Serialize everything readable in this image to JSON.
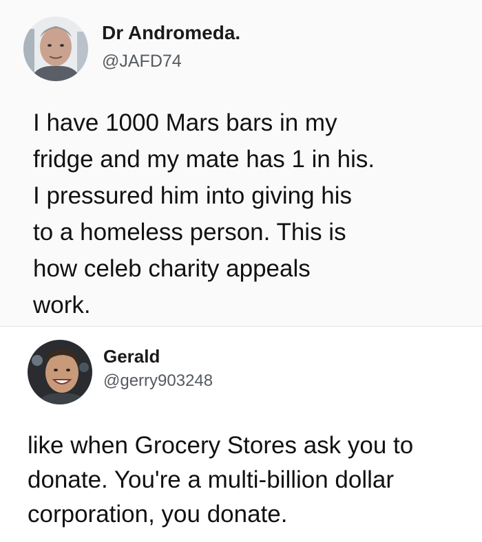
{
  "tweets": [
    {
      "display_name": "Dr Andromeda.",
      "handle": "@JAFD74",
      "avatar_icon": "profile-photo",
      "text": "I have 1000 Mars bars in my\nfridge and my mate has 1 in his.\nI pressured him into giving his\nto a homeless person. This is\nhow celeb charity appeals\nwork."
    },
    {
      "display_name": "Gerald",
      "handle": "@gerry903248",
      "avatar_icon": "profile-photo",
      "text": "like when Grocery Stores ask you to\ndonate. You're a multi-billion dollar\ncorporation, you donate."
    }
  ],
  "colors": {
    "background": "#ffffff",
    "text": "#111111",
    "handle": "#555a60",
    "divider": "#e4e4e4"
  }
}
